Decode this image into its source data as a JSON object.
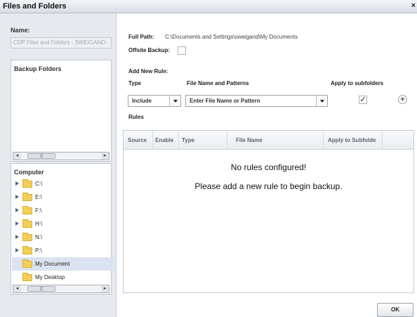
{
  "window": {
    "title": "Files and Folders"
  },
  "left": {
    "name_label": "Name:",
    "name_value": "CDP Files and Folders - SWEIGAND-",
    "backup_folders_label": "Backup Folders",
    "computer_label": "Computer",
    "tree": [
      {
        "label": "C:\\",
        "expandable": true,
        "selected": false
      },
      {
        "label": "E:\\",
        "expandable": true,
        "selected": false
      },
      {
        "label": "F:\\",
        "expandable": true,
        "selected": false
      },
      {
        "label": "H:\\",
        "expandable": true,
        "selected": false
      },
      {
        "label": "N:\\",
        "expandable": true,
        "selected": false
      },
      {
        "label": "P:\\",
        "expandable": true,
        "selected": false
      },
      {
        "label": "My Document",
        "expandable": false,
        "selected": true
      },
      {
        "label": "My Desktop",
        "expandable": false,
        "selected": false
      }
    ],
    "scroll_thumb": "|||"
  },
  "right": {
    "full_path_label": "Full Path:",
    "full_path_value": "C:\\Documents and Settings\\sweigand\\My Documents",
    "offsite_backup_label": "Offsite Backup:",
    "add_new_rule_label": "Add New Rule:",
    "type_header": "Type",
    "pattern_header": "File Name and Patterns",
    "apply_header": "Apply to subfolders",
    "type_value": "Include",
    "pattern_placeholder": "Enter File Name or Pattern",
    "apply_checked_mark": "✓",
    "add_icon": "+",
    "rules_label": "Rules",
    "columns": [
      "Source",
      "Enable",
      "Type",
      "File Name",
      "Apply to Subfolde"
    ],
    "empty_line1": "No rules configured!",
    "empty_line2": "Please add a new rule to begin backup."
  },
  "footer": {
    "ok_label": "OK"
  },
  "icons": {
    "close": "close-icon",
    "folder": "folder-icon",
    "expander": "chevron-right-icon",
    "add": "plus-circle-icon"
  }
}
